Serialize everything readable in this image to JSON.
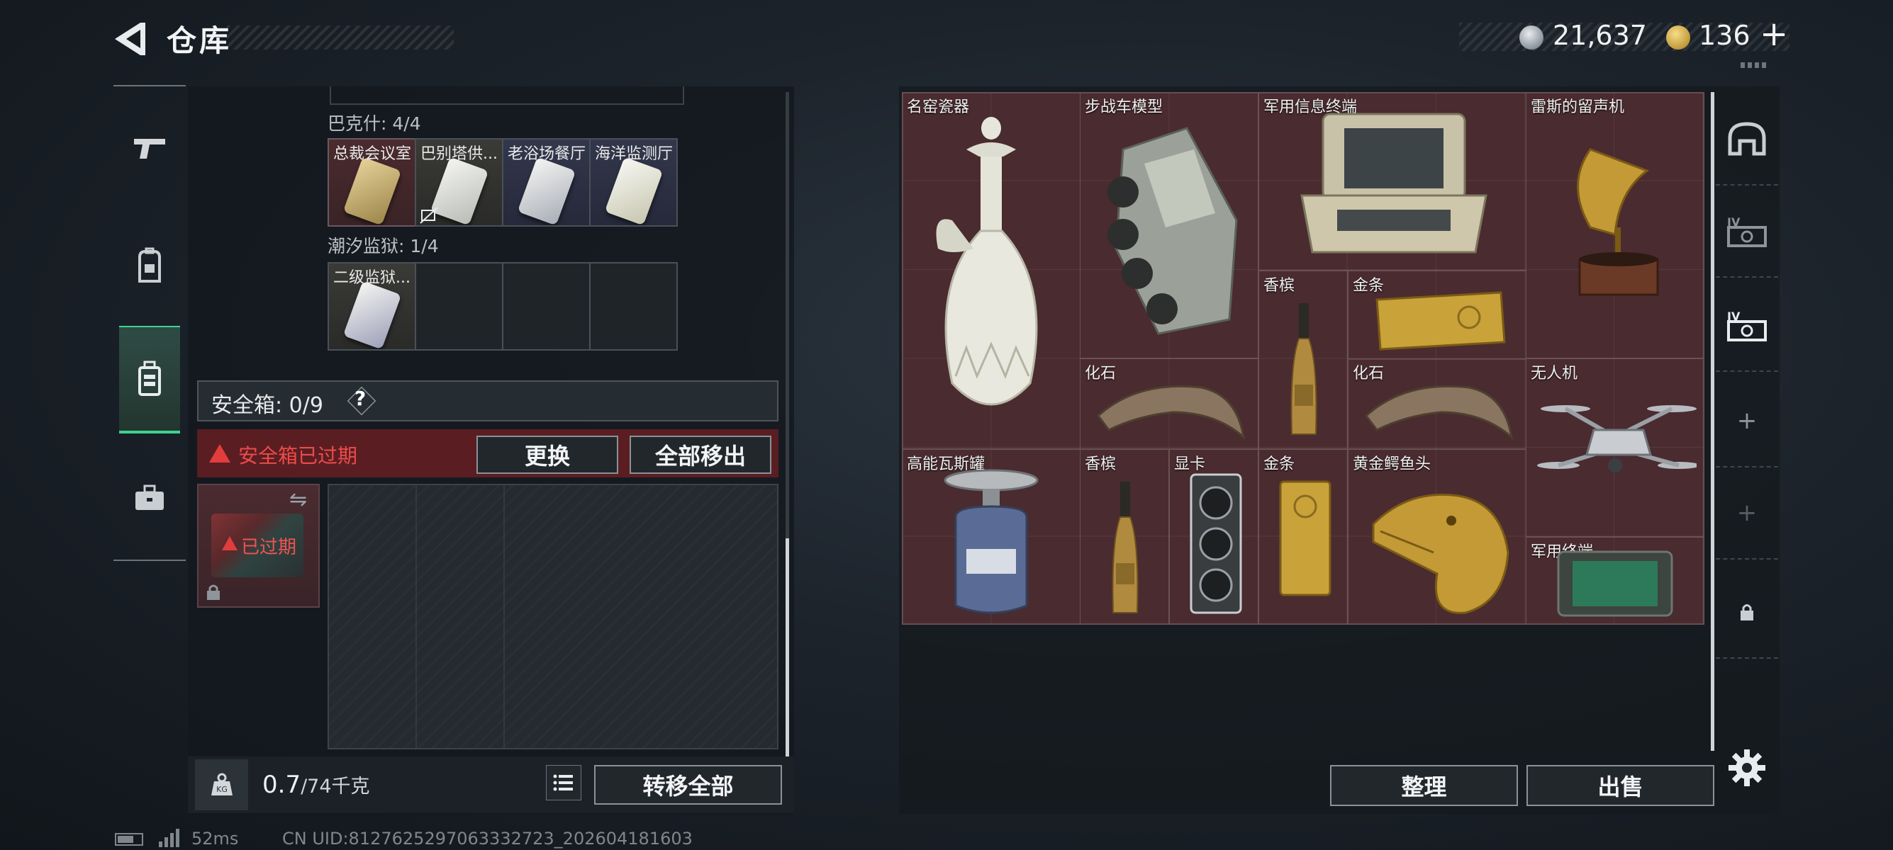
{
  "header": {
    "title": "仓库",
    "currency_silver": "21,637",
    "currency_gold": "136",
    "plus_label": "+"
  },
  "left_nav": {
    "items": [
      "weapon-icon",
      "backpack-icon",
      "vest-icon",
      "briefcase-icon"
    ],
    "active": "vest-icon"
  },
  "keycards": {
    "group1_label": "巴克什: 4/4",
    "group1_slots": [
      "总裁会议室",
      "巴别塔供...",
      "老浴场餐厅",
      "海洋监测厅"
    ],
    "group2_label": "潮汐监狱: 1/4",
    "group2_slots": [
      "二级监狱..."
    ]
  },
  "safebox": {
    "label": "安全箱: 0/9",
    "help": "?",
    "expired_notice": "安全箱已过期",
    "replace_button": "更换",
    "move_all_button": "全部移出",
    "item_status": "已过期"
  },
  "footer_left": {
    "weight_current": "0.7",
    "weight_max": "/74千克",
    "transfer_all_button": "转移全部"
  },
  "inventory": {
    "items": [
      {
        "name": "名窑瓷器",
        "art": "porcelain-vase"
      },
      {
        "name": "步战车模型",
        "art": "ifv-model"
      },
      {
        "name": "军用信息终端",
        "art": "military-info-terminal"
      },
      {
        "name": "雷斯的留声机",
        "art": "gramophone"
      },
      {
        "name": "香槟",
        "art": "champagne"
      },
      {
        "name": "金条",
        "art": "gold-bar"
      },
      {
        "name": "化石",
        "art": "fossil-claw"
      },
      {
        "name": "化石",
        "art": "fossil-claw"
      },
      {
        "name": "无人机",
        "art": "drone"
      },
      {
        "name": "高能瓦斯罐",
        "art": "gas-canister"
      },
      {
        "name": "香槟",
        "art": "champagne"
      },
      {
        "name": "显卡",
        "art": "graphics-card"
      },
      {
        "name": "金条",
        "art": "gold-bar"
      },
      {
        "name": "黄金鳄鱼头",
        "art": "golden-crocodile-head"
      },
      {
        "name": "军用终端",
        "art": "military-terminal"
      }
    ],
    "sort_button": "整理",
    "sell_button": "出售"
  },
  "right_nav": {
    "items": [
      "helmet-icon",
      "iv-armor-icon",
      "iv-armor-icon",
      "add-slot",
      "add-slot",
      "lock-icon"
    ],
    "add_label": "+"
  },
  "status": {
    "ping": "52ms",
    "uid": "CN UID:8127625297063332723_202604181603"
  },
  "colors": {
    "accent_green": "#3fd38f",
    "warning_red": "#e23d3d",
    "item_bg": "#472a2e"
  }
}
